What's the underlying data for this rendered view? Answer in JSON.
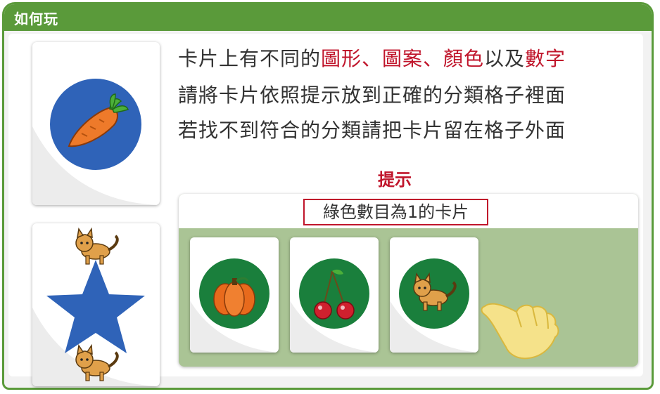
{
  "header": {
    "title": "如何玩"
  },
  "instructions": {
    "line1_prefix": "卡片上有不同的",
    "line1_red1": "圖形、圖案、顏色",
    "line1_mid": "以及",
    "line1_red2": "數字",
    "line2": "請將卡片依照提示放到正確的分類格子裡面",
    "line3": "若找不到符合的分類請把卡片留在格子外面"
  },
  "hint": {
    "label": "提示",
    "rule": "綠色數目為1的卡片"
  },
  "colors": {
    "header_green": "#5a9a3a",
    "box_green": "#aac495",
    "card_blue": "#2f63b8",
    "card_green": "#1a7f3c",
    "accent_red": "#c0152b"
  },
  "cards_left": [
    {
      "icon": "carrot-icon",
      "shape": "circle",
      "color": "blue"
    },
    {
      "icon": "star-with-cats-icon",
      "shape": "star",
      "color": "blue",
      "cats": 2
    }
  ],
  "cards_in_box": [
    {
      "icon": "pumpkin-icon",
      "shape": "circle",
      "color": "green"
    },
    {
      "icon": "cherry-icon",
      "shape": "circle",
      "color": "green"
    },
    {
      "icon": "cat-icon",
      "shape": "circle",
      "color": "green"
    }
  ]
}
